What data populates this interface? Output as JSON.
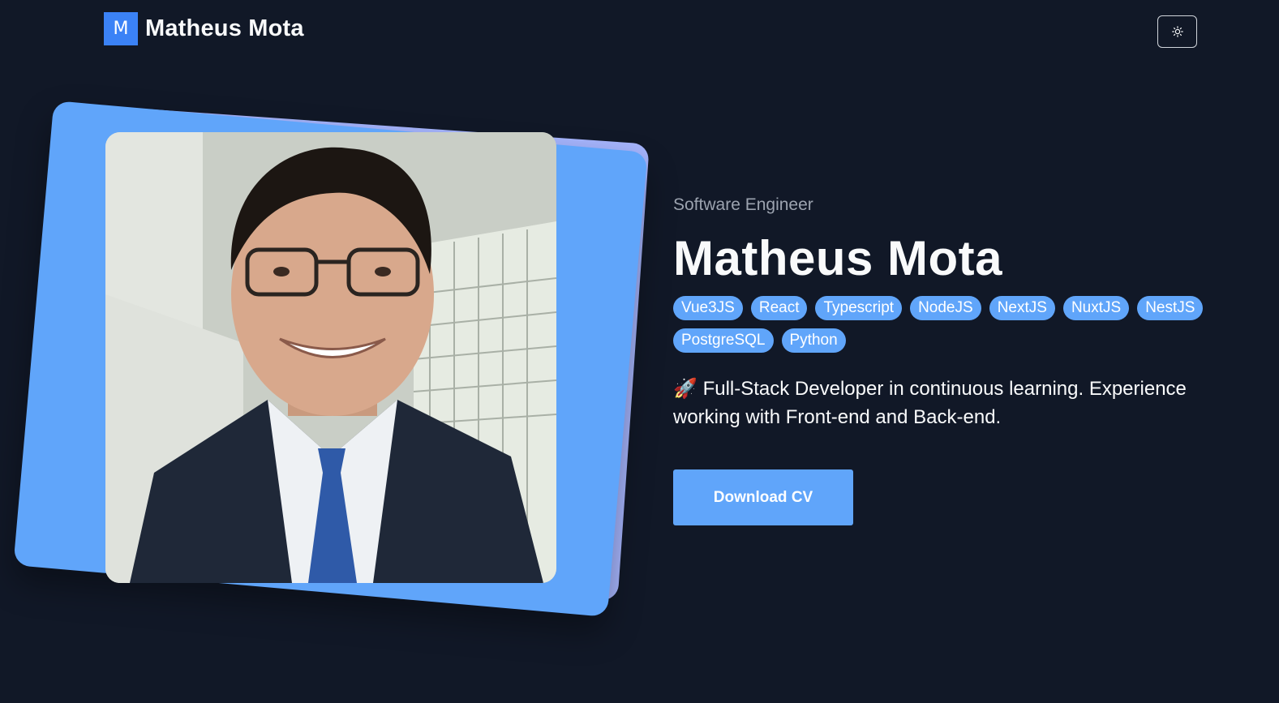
{
  "header": {
    "logo_letter": "M",
    "logo_text": "Matheus Mota",
    "theme_toggle_icon": "sun-icon"
  },
  "hero": {
    "subtitle": "Software Engineer",
    "title": "Matheus Mota",
    "tags": [
      "Vue3JS",
      "React",
      "Typescript",
      "NodeJS",
      "NextJS",
      "NuxtJS",
      "NestJS",
      "PostgreSQL",
      "Python"
    ],
    "description_icon": "🚀",
    "description": "Full-Stack Developer in continuous learning. Experience working with Front-end and Back-end.",
    "download_label": "Download CV"
  },
  "colors": {
    "background": "#111827",
    "accent": "#60a5fa",
    "accent_back": "#a5b4fc",
    "logo_bg": "#3b82f6"
  }
}
